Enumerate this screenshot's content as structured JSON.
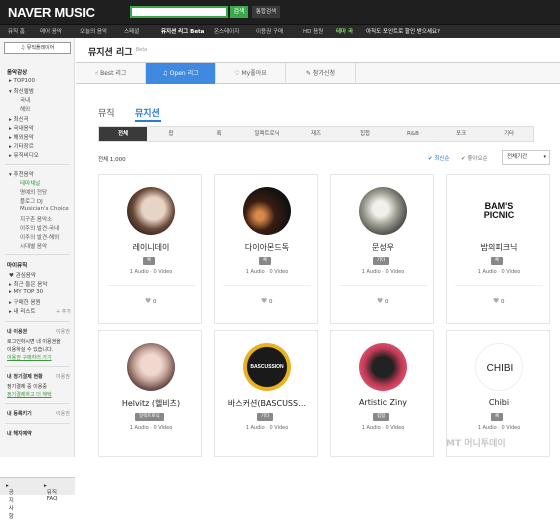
{
  "header": {
    "logo_naver": "NAVER",
    "logo_music": "MUSIC",
    "search_button": "검색",
    "integrated_search": "통합검색"
  },
  "gnb": [
    {
      "label": "뮤직 홈"
    },
    {
      "label": "매어 음악"
    },
    {
      "label": "오늘의 음악"
    },
    {
      "label": "스페셜"
    },
    {
      "label": "뮤지션 리그 Beta"
    },
    {
      "label": "온스테이지"
    },
    {
      "label": "이용권 구매"
    },
    {
      "label": "HD 음원"
    },
    {
      "label": "테마 곡"
    },
    {
      "label": "아직도 포인트로 할인 받으세요?"
    }
  ],
  "sidebar": {
    "player_label": "뮤직플레이어",
    "section_explore": "음악감상",
    "explore_items": [
      "TOP100",
      "최신앨범",
      "국내",
      "해외",
      "최신곡",
      "국내음악",
      "해외음악",
      "기타장르",
      "뮤직비디오"
    ],
    "recommend_items": [
      "추천음악",
      "테마채널",
      "명예의 전당",
      "플로그 DJ",
      "Musician's Choice",
      "지구촌 음악소",
      "이주의 발견-국내",
      "이주의 발견-해외",
      "시대별 음악"
    ],
    "section_my": "마이뮤직",
    "my_items": [
      "관심음악",
      "최근 들은 음악",
      "MY TOP 30",
      "구매한 음원",
      "내 리스트"
    ],
    "add_label": "+ 추가",
    "ticket_title": "내 이용권",
    "ticket_help": "이용권",
    "ticket_text1": "로그인하시면 내 이용권을",
    "ticket_text2": "이용하실 수 있습니다.",
    "ticket_link": "이용권 구매하러 가기",
    "schedule_title": "내 정기결제 현황",
    "schedule_help": "이용권",
    "schedule_text1": "정기결제 중 이용중",
    "schedule_link": "정기결제하고 더 혜택",
    "reg_title": "내 등록키기",
    "reg_help": "이용권",
    "cancel_title": "내 해지예약",
    "footer_player": "공지사항",
    "footer_faq": "뮤직FAQ"
  },
  "main": {
    "title": "뮤지션 리그",
    "title_sup": "Beta",
    "tabs": [
      "Best 리그",
      "Open 리그",
      "My좋아요",
      "참가신청"
    ],
    "tab_icons": [
      "thumb-icon",
      "music-note-icon",
      "heart-icon",
      "edit-icon"
    ],
    "subtab_music": "뮤직",
    "subtab_musician": "뮤지션",
    "genres": [
      "전체",
      "팝",
      "록",
      "일렉트로닉",
      "재즈",
      "힙합",
      "R&B",
      "포크",
      "기타"
    ],
    "total": "전체 1,000",
    "sort_new": "✔ 최신순",
    "sort_like": "✔ 좋아요순",
    "period": "전체기간",
    "cards": [
      {
        "name": "레이니데이",
        "genre": "록",
        "audio": "1 Audio",
        "video": "0 Video",
        "likes": "0"
      },
      {
        "name": "다이아몬드독",
        "genre": "록",
        "audio": "1 Audio",
        "video": "0 Video",
        "likes": "0"
      },
      {
        "name": "문성우",
        "genre": "기타",
        "audio": "1 Audio",
        "video": "0 Video",
        "likes": "0"
      },
      {
        "name": "밤의피크닉",
        "genre": "록",
        "audio": "1 Audio",
        "video": "0 Video",
        "likes": "0"
      },
      {
        "name": "Helvitz (헬비츠)",
        "genre": "일렉트로닉",
        "audio": "1 Audio",
        "video": "0 Video",
        "likes": "0"
      },
      {
        "name": "바스커션(BASCUSS…",
        "genre": "기타",
        "audio": "1 Audio",
        "video": "0 Video",
        "likes": "0"
      },
      {
        "name": "Artistic Ziny",
        "genre": "힙합",
        "audio": "1 Audio",
        "video": "0 Video",
        "likes": "0"
      },
      {
        "name": "Chibi",
        "genre": "록",
        "audio": "1 Audio",
        "video": "0 Video",
        "likes": "0"
      }
    ],
    "avatar_texts": {
      "bams_1": "BAM'S",
      "bams_2": "PICNIC",
      "bascussion": "BASCUSSION",
      "chibi": "CHIBI"
    }
  },
  "watermark": "MT 머니투데이",
  "colors": {
    "accent": "#3f8ae0",
    "naver_green": "#3aa84b",
    "header_bg": "#1f1f1f"
  }
}
